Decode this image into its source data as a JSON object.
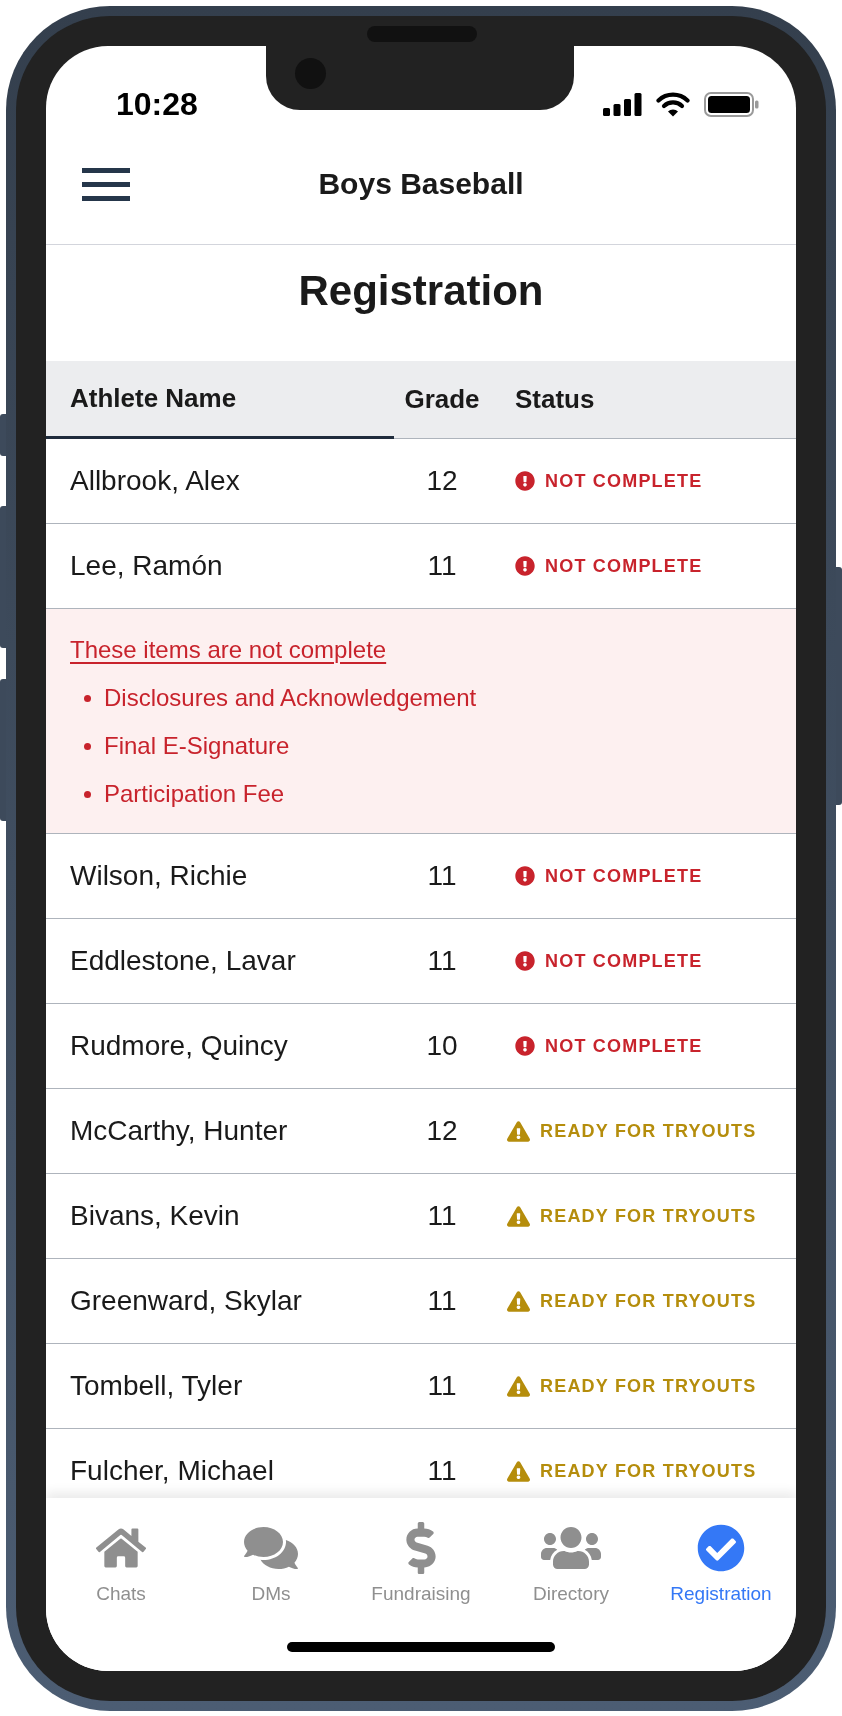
{
  "status_bar": {
    "time": "10:28"
  },
  "header": {
    "title": "Boys Baseball"
  },
  "page_title": "Registration",
  "table": {
    "columns": [
      {
        "label": "Athlete Name",
        "selected": true
      },
      {
        "label": "Grade",
        "selected": false
      },
      {
        "label": "Status",
        "selected": false
      }
    ],
    "rows": [
      {
        "name": "Allbrook, Alex",
        "grade": "12",
        "status": {
          "kind": "not_complete",
          "label": "NOT COMPLETE"
        },
        "expanded": false
      },
      {
        "name": "Lee, Ramón",
        "grade": "11",
        "status": {
          "kind": "not_complete",
          "label": "NOT COMPLETE"
        },
        "expanded": true,
        "details": {
          "heading": "These items are not complete",
          "items": [
            "Disclosures and Acknowledgement",
            "Final E-Signature",
            "Participation Fee"
          ]
        }
      },
      {
        "name": "Wilson, Richie",
        "grade": "11",
        "status": {
          "kind": "not_complete",
          "label": "NOT COMPLETE"
        },
        "expanded": false
      },
      {
        "name": "Eddlestone, Lavar",
        "grade": "11",
        "status": {
          "kind": "not_complete",
          "label": "NOT COMPLETE"
        },
        "expanded": false
      },
      {
        "name": "Rudmore, Quincy",
        "grade": "10",
        "status": {
          "kind": "not_complete",
          "label": "NOT COMPLETE"
        },
        "expanded": false
      },
      {
        "name": "McCarthy, Hunter",
        "grade": "12",
        "status": {
          "kind": "ready",
          "label": "READY FOR TRYOUTS"
        },
        "expanded": false
      },
      {
        "name": "Bivans, Kevin",
        "grade": "11",
        "status": {
          "kind": "ready",
          "label": "READY FOR TRYOUTS"
        },
        "expanded": false
      },
      {
        "name": "Greenward, Skylar",
        "grade": "11",
        "status": {
          "kind": "ready",
          "label": "READY FOR TRYOUTS"
        },
        "expanded": false
      },
      {
        "name": "Tombell, Tyler",
        "grade": "11",
        "status": {
          "kind": "ready",
          "label": "READY FOR TRYOUTS"
        },
        "expanded": false
      },
      {
        "name": "Fulcher, Michael",
        "grade": "11",
        "status": {
          "kind": "ready",
          "label": "READY FOR TRYOUTS"
        },
        "expanded": false
      }
    ]
  },
  "tab_bar": {
    "items": [
      {
        "label": "Chats",
        "selected": false
      },
      {
        "label": "DMs",
        "selected": false
      },
      {
        "label": "Fundraising",
        "selected": false
      },
      {
        "label": "Directory",
        "selected": false
      },
      {
        "label": "Registration",
        "selected": true
      }
    ]
  }
}
